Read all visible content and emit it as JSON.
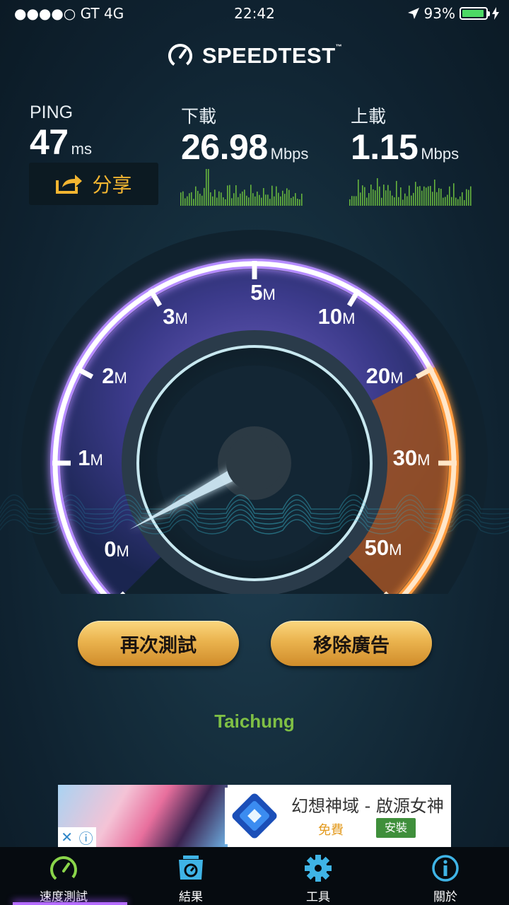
{
  "status_bar": {
    "carrier": "●●●●○ GT   4G",
    "time": "22:42",
    "battery": "93%",
    "battery_level": 0.93
  },
  "header": {
    "app_name": "SPEEDTEST",
    "trademark": "™"
  },
  "stats": {
    "ping": {
      "label": "PING",
      "value": "47",
      "unit": "ms"
    },
    "download": {
      "label": "下載",
      "value": "26.98",
      "unit": "Mbps"
    },
    "upload": {
      "label": "上載",
      "value": "1.15",
      "unit": "Mbps"
    }
  },
  "share_button": {
    "label": "分享"
  },
  "gauge": {
    "labels": [
      {
        "num": "0",
        "unit": "M"
      },
      {
        "num": "1",
        "unit": "M"
      },
      {
        "num": "2",
        "unit": "M"
      },
      {
        "num": "3",
        "unit": "M"
      },
      {
        "num": "5",
        "unit": "M"
      },
      {
        "num": "10",
        "unit": "M"
      },
      {
        "num": "20",
        "unit": "M"
      },
      {
        "num": "30",
        "unit": "M"
      },
      {
        "num": "50",
        "unit": "M"
      }
    ],
    "needle_value_mbps": 0,
    "accent_purple": "#b58cff",
    "accent_orange": "#ff9a3c"
  },
  "actions": {
    "retest": "再次測試",
    "remove_ads": "移除廣告"
  },
  "server": {
    "city": "Taichung"
  },
  "ad": {
    "title": "幻想神域 - 啟源女神",
    "free": "免費",
    "install": "安裝"
  },
  "tabs": [
    {
      "label": "速度測試",
      "icon": "speedometer-icon",
      "color": "#8ad54a"
    },
    {
      "label": "結果",
      "icon": "results-icon",
      "color": "#3fb4e6"
    },
    {
      "label": "工具",
      "icon": "gear-icon",
      "color": "#3fb4e6"
    },
    {
      "label": "關於",
      "icon": "info-icon",
      "color": "#3fb4e6"
    }
  ]
}
